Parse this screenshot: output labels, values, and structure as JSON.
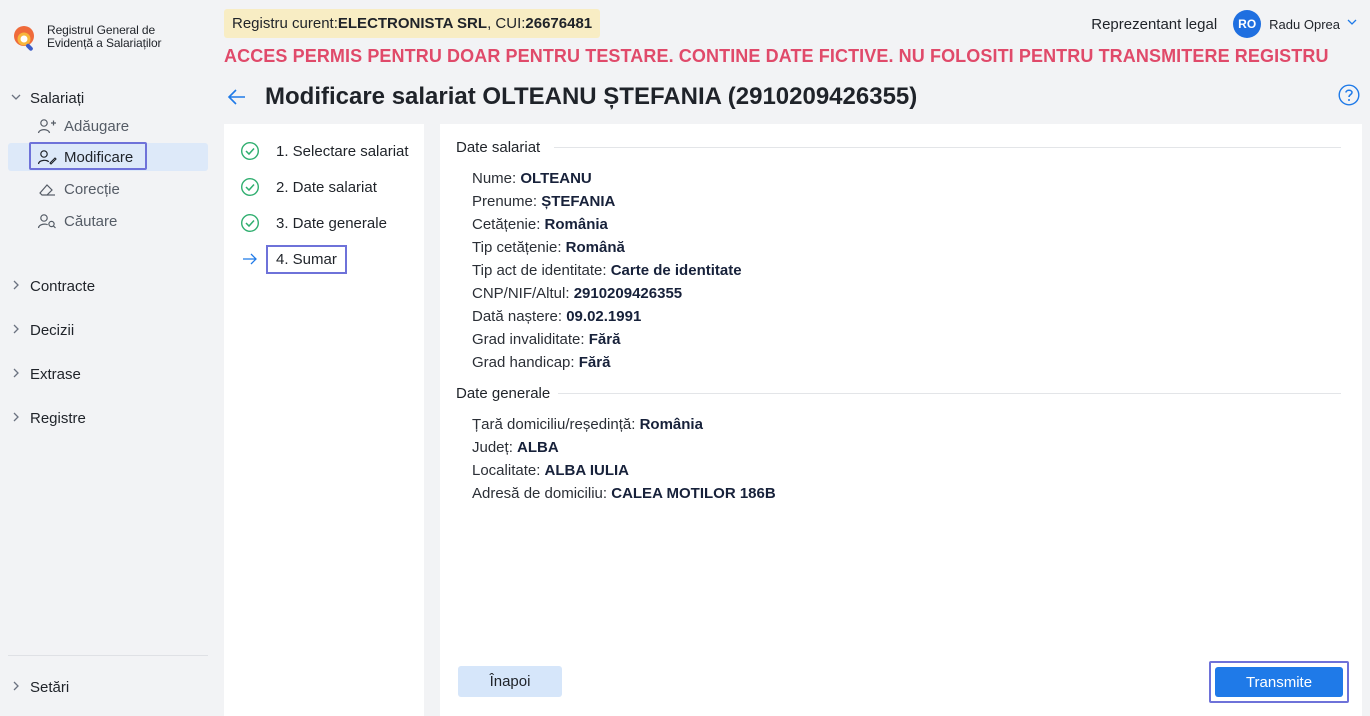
{
  "app": {
    "logo_line1": "Registrul General de",
    "logo_line2": "Evidență a Salariaților"
  },
  "sidebar": {
    "groups": [
      {
        "label": "Salariați",
        "expanded": true
      },
      {
        "label": "Contracte"
      },
      {
        "label": "Decizii"
      },
      {
        "label": "Extrase"
      },
      {
        "label": "Registre"
      },
      {
        "label": "Setări"
      }
    ],
    "items": [
      {
        "label": "Adăugare",
        "icon": "user-add-icon"
      },
      {
        "label": "Modificare",
        "icon": "user-edit-icon",
        "active": true
      },
      {
        "label": "Corecție",
        "icon": "eraser-icon"
      },
      {
        "label": "Căutare",
        "icon": "user-search-icon"
      }
    ]
  },
  "header": {
    "registry_prefix": "Registru curent: ",
    "registry_name": "ELECTRONISTA SRL",
    "cui_prefix": ", CUI: ",
    "cui": "26676481",
    "warning": "ACCES PERMIS PENTRU DOAR PENTRU TESTARE. CONTINE DATE FICTIVE. NU FOLOSITI PENTRU TRANSMITERE REGISTRU",
    "role": "Reprezentant legal",
    "avatar_initials": "RO",
    "user_name": "Radu Oprea"
  },
  "page": {
    "title": "Modificare salariat OLTEANU  ȘTEFANIA (2910209426355)"
  },
  "steps": [
    {
      "label": "1. Selectare salariat",
      "status": "done"
    },
    {
      "label": "2. Date salariat",
      "status": "done"
    },
    {
      "label": "3. Date generale",
      "status": "done"
    },
    {
      "label": "4. Sumar",
      "status": "current"
    }
  ],
  "summary": {
    "section1_title": "Date salariat",
    "section1_fields": [
      {
        "label": "Nume: ",
        "value": "OLTEANU"
      },
      {
        "label": "Prenume:  ",
        "value": "ȘTEFANIA"
      },
      {
        "label": "Cetățenie: ",
        "value": "România"
      },
      {
        "label": "Tip cetățenie: ",
        "value": "Română"
      },
      {
        "label": "Tip act de identitate: ",
        "value": "Carte de identitate"
      },
      {
        "label": "CNP/NIF/Altul: ",
        "value": "2910209426355"
      },
      {
        "label": "Dată naștere: ",
        "value": "09.02.1991"
      },
      {
        "label": "Grad invaliditate: ",
        "value": "Fără"
      },
      {
        "label": "Grad handicap: ",
        "value": "Fără"
      }
    ],
    "section2_title": "Date generale",
    "section2_fields": [
      {
        "label": "Țară domiciliu/reședință: ",
        "value": "România"
      },
      {
        "label": "Județ: ",
        "value": "ALBA"
      },
      {
        "label": "Localitate: ",
        "value": "ALBA IULIA"
      },
      {
        "label": "Adresă de domiciliu: ",
        "value": "CALEA MOTILOR 186B"
      }
    ]
  },
  "actions": {
    "back_label": "Înapoi",
    "submit_label": "Transmite"
  },
  "colors": {
    "primary": "#1f7ae8",
    "warning": "#e04a6a",
    "highlight": "#6e72d9",
    "badge_bg": "#f8edc4",
    "success": "#2fae6f"
  }
}
